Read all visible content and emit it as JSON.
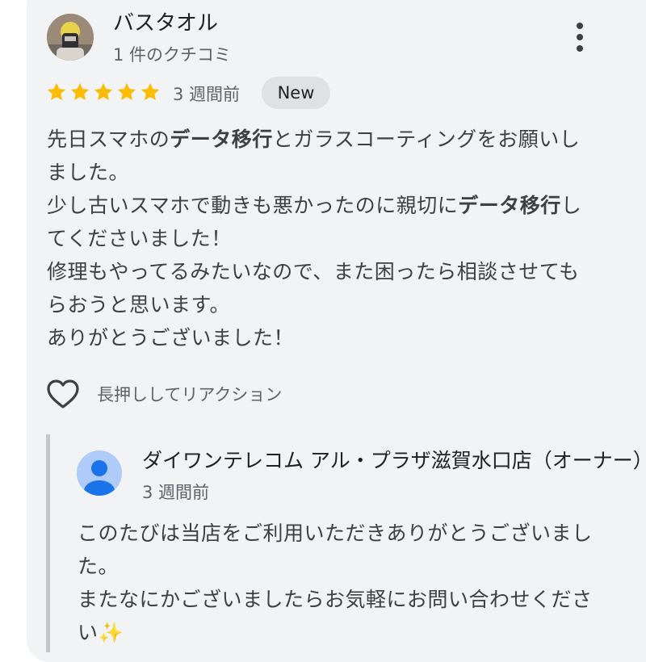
{
  "review": {
    "author_name": "バスタオル",
    "author_meta": "1 件のクチコミ",
    "rating": 5,
    "rating_max": 5,
    "time_ago": "3 週間前",
    "badge": "New",
    "text": {
      "p1": "先日スマホの",
      "b1": "データ移行",
      "p2": "とガラスコーティングをお願いしました。",
      "p3": "少し古いスマホで動きも悪かったのに親切に",
      "b2": "データ移行",
      "p4": "してくださいました！",
      "p5": "修理もやってるみたいなので、また困ったら相談させてもらおうと思います。",
      "p6": "ありがとうございました！"
    },
    "reaction_label": "長押ししてリアクション"
  },
  "owner_reply": {
    "name": "ダイワンテレコム アル・プラザ滋賀水口店（オーナー）",
    "time_ago": "3 週間前",
    "text": {
      "p1": "このたびは当店をご利用いただきありがとうございました。",
      "p2": "またなにかございましたらお気軽にお問い合わせください✨"
    }
  },
  "colors": {
    "card_bg": "#f1f3f4",
    "star": "#fbbc04",
    "badge_bg": "#dfe1e5",
    "owner_avatar_bg": "#aecbfa",
    "owner_avatar_fg": "#1a73e8"
  },
  "icons": {
    "more": "more-vert-icon",
    "star": "star-icon",
    "reaction": "heart-outline-icon",
    "owner_avatar": "person-icon"
  }
}
